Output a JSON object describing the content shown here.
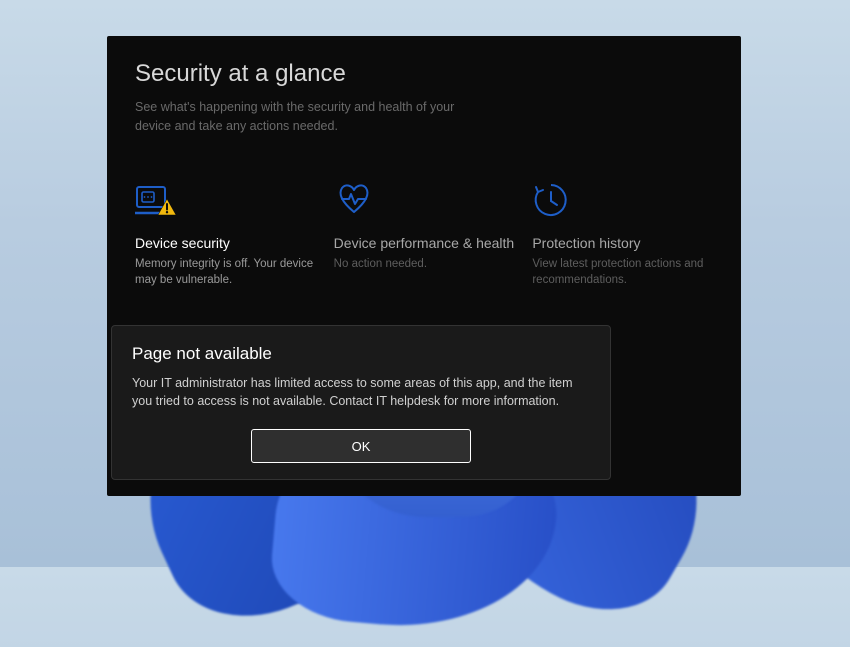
{
  "header": {
    "title": "Security at a glance",
    "subtitle": "See what's happening with the security and health of your device and take any actions needed."
  },
  "cards": [
    {
      "icon": "device-security-icon",
      "title": "Device security",
      "desc": "Memory integrity is off. Your device may be vulnerable.",
      "status": "warning",
      "active": true
    },
    {
      "icon": "device-performance-icon",
      "title": "Device performance & health",
      "desc": "No action needed.",
      "status": "ok",
      "active": false
    },
    {
      "icon": "protection-history-icon",
      "title": "Protection history",
      "desc": "View latest protection actions and recommendations.",
      "status": "info",
      "active": false
    }
  ],
  "dialog": {
    "title": "Page not available",
    "body": "Your IT administrator has limited access to some areas of this app, and the item you tried to access is not available. Contact IT helpdesk for more information.",
    "ok_label": "OK"
  },
  "colors": {
    "accent": "#1e5ec8",
    "warning": "#f2b90e"
  }
}
